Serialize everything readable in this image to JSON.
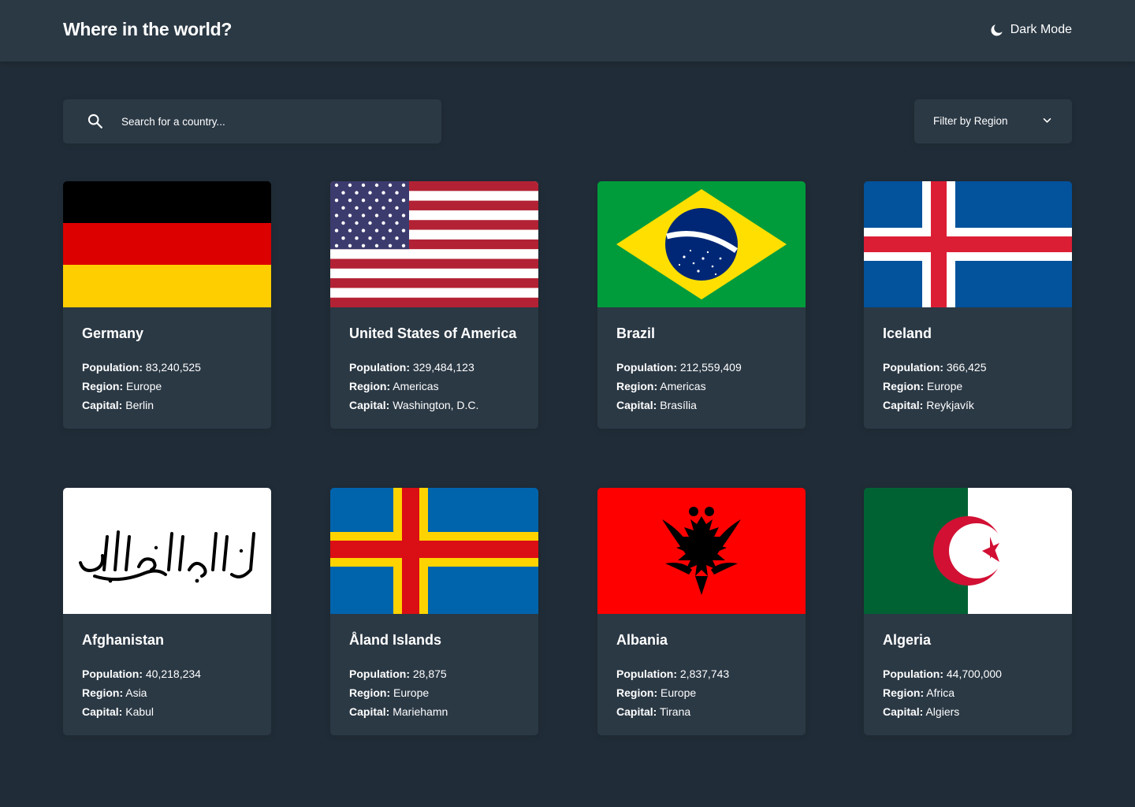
{
  "header": {
    "title": "Where in the world?",
    "theme_toggle_label": "Dark Mode",
    "theme_icon": "moon-icon"
  },
  "search": {
    "placeholder": "Search for a country...",
    "value": "",
    "icon": "search-icon"
  },
  "filter": {
    "label": "Filter by Region",
    "icon": "chevron-down-icon"
  },
  "labels": {
    "population": "Population:",
    "region": "Region:",
    "capital": "Capital:"
  },
  "countries": [
    {
      "name": "Germany",
      "population": "83,240,525",
      "region": "Europe",
      "capital": "Berlin"
    },
    {
      "name": "United States of America",
      "population": "329,484,123",
      "region": "Americas",
      "capital": "Washington, D.C."
    },
    {
      "name": "Brazil",
      "population": "212,559,409",
      "region": "Americas",
      "capital": "Brasília"
    },
    {
      "name": "Iceland",
      "population": "366,425",
      "region": "Europe",
      "capital": "Reykjavík"
    },
    {
      "name": "Afghanistan",
      "population": "40,218,234",
      "region": "Asia",
      "capital": "Kabul"
    },
    {
      "name": "Åland Islands",
      "population": "28,875",
      "region": "Europe",
      "capital": "Mariehamn"
    },
    {
      "name": "Albania",
      "population": "2,837,743",
      "region": "Europe",
      "capital": "Tirana"
    },
    {
      "name": "Algeria",
      "population": "44,700,000",
      "region": "Africa",
      "capital": "Algiers"
    }
  ],
  "colors": {
    "background": "#202c37",
    "surface": "#2b3945",
    "text": "#ffffff"
  }
}
